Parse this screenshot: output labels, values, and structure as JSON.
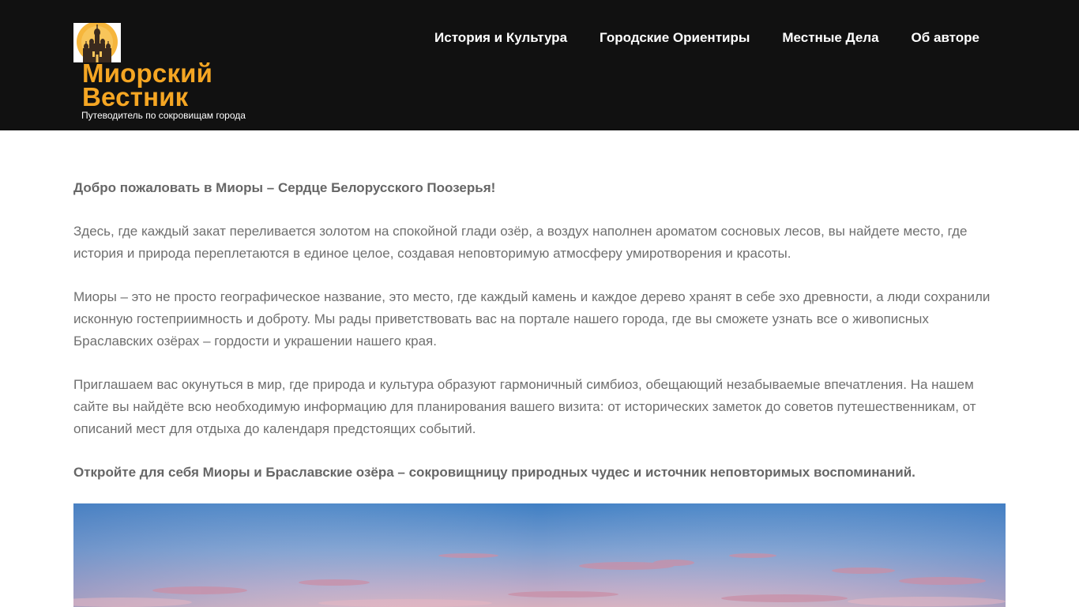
{
  "header": {
    "site_title_line1": "Миорский",
    "site_title_line2": "Вестник",
    "tagline": "Путеводитель по сокровищам города",
    "logo_icon": "church-icon",
    "colors": {
      "background": "#111111",
      "title": "#f5a623",
      "nav_text": "#ffffff"
    }
  },
  "nav": {
    "items": [
      {
        "label": "История и Культура"
      },
      {
        "label": "Городские Ориентиры"
      },
      {
        "label": "Местные Дела"
      },
      {
        "label": "Об авторе"
      }
    ]
  },
  "main": {
    "welcome_heading": "Добро пожаловать в Миоры – Сердце Белорусского Поозерья!",
    "paragraphs": [
      "Здесь, где каждый закат переливается золотом на спокойной глади озёр, а воздух наполнен ароматом сосновых лесов, вы найдете место, где история и природа переплетаются в единое целое, создавая неповторимую атмосферу умиротворения и красоты.",
      "Миоры – это не просто географическое название, это место, где каждый камень и каждое дерево хранят в себе эхо древности, а люди сохранили исконную гостеприимность и доброту. Мы рады приветствовать вас на портале нашего города, где вы сможете узнать все о живописных Браславских озёрах – гордости и украшении нашего края.",
      "Приглашаем вас окунуться в мир, где природа и культура образуют гармоничный симбиоз, обещающий незабываемые впечатления. На нашем сайте вы найдёте всю необходимую информацию для планирования вашего визита: от исторических заметок до советов путешественникам, от описаний мест для отдыха до календаря предстоящих событий."
    ],
    "closing": "Откройте для себя Миоры и Браславские озёра – сокровищницу природных чудес и источник неповторимых воспоминаний.",
    "hero_image": "sunset-sky-image"
  }
}
